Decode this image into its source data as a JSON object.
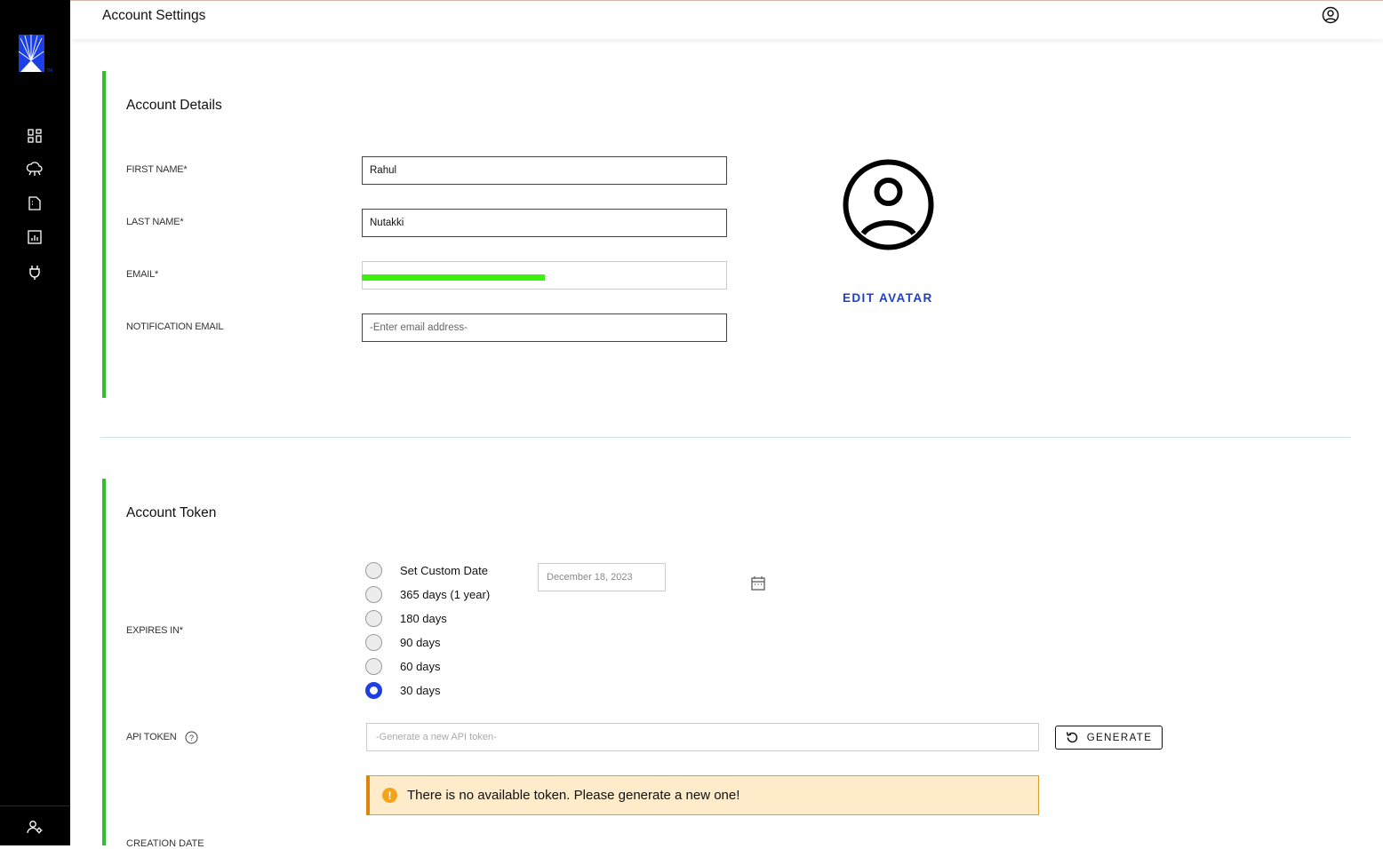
{
  "header": {
    "title": "Account Settings",
    "profile_icon": "user-circle-icon"
  },
  "sidebar": {
    "logo": "brand-logo",
    "items": [
      {
        "icon": "dashboard-grid-icon"
      },
      {
        "icon": "cloud-network-icon"
      },
      {
        "icon": "document-icon"
      },
      {
        "icon": "bar-chart-icon"
      },
      {
        "icon": "plug-icon"
      }
    ],
    "bottom_icon": "user-settings-icon"
  },
  "account_details": {
    "title": "Account Details",
    "first_name": {
      "label": "FIRST NAME*",
      "value": "Rahul"
    },
    "last_name": {
      "label": "LAST NAME*",
      "value": "Nutakki"
    },
    "email": {
      "label": "EMAIL*",
      "value": ""
    },
    "notification_email": {
      "label": "NOTIFICATION EMAIL",
      "placeholder": "-Enter email address-"
    },
    "edit_avatar": "EDIT AVATAR"
  },
  "account_token": {
    "title": "Account Token",
    "expires_label": "EXPIRES IN*",
    "options": [
      {
        "label": "Set Custom Date",
        "checked": false
      },
      {
        "label": "365 days (1 year)",
        "checked": false
      },
      {
        "label": "180 days",
        "checked": false
      },
      {
        "label": "90 days",
        "checked": false
      },
      {
        "label": "60 days",
        "checked": false
      },
      {
        "label": "30 days",
        "checked": true
      }
    ],
    "custom_date": "December 18, 2023",
    "api_token_label": "API TOKEN",
    "api_token_placeholder": "-Generate a new API token-",
    "generate_label": "GENERATE",
    "alert": "There is no available token. Please generate a new one!",
    "next_label": "CREATION DATE"
  },
  "colors": {
    "accent_green": "#2fbf2f",
    "link_blue": "#1d3fc4",
    "radio_blue": "#1d3fe0",
    "alert_bg": "#fdebc9",
    "alert_border": "#e0820f"
  }
}
